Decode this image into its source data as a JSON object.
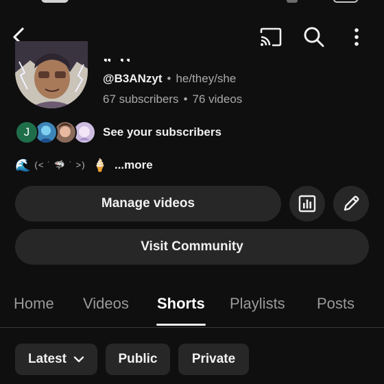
{
  "topbar": {
    "back_icon": "chevron-left-icon",
    "cast_icon": "cast-icon",
    "search_icon": "search-icon",
    "more_icon": "more-vertical-icon"
  },
  "channel": {
    "name_partial": "„ ‚‚",
    "handle": "@B3ANzyt",
    "separator": "•",
    "pronouns": "he/they/she",
    "subscribers": "67 subscribers",
    "videos": "76 videos"
  },
  "subscribers_row": {
    "first_initial": "J",
    "label": "See your subscribers"
  },
  "bio": {
    "emoji_wave": "🌊",
    "kaomoji": "(˂ ˙ 🦈 ˙ ˃)",
    "emoji_icecream": "🍦",
    "more": "...more"
  },
  "actions": {
    "manage_videos": "Manage videos",
    "analytics_icon": "analytics-icon",
    "edit_icon": "pencil-icon",
    "visit_community": "Visit Community"
  },
  "tabs": [
    {
      "label": "Home",
      "active": false
    },
    {
      "label": "Videos",
      "active": false
    },
    {
      "label": "Shorts",
      "active": true
    },
    {
      "label": "Playlists",
      "active": false
    },
    {
      "label": "Posts",
      "active": false
    }
  ],
  "filters": {
    "sort": "Latest",
    "public": "Public",
    "private": "Private"
  },
  "colors": {
    "background": "#0f0f0f",
    "surface": "#272727",
    "text_primary": "#f1f1f1",
    "text_secondary": "#aaaaaa"
  }
}
